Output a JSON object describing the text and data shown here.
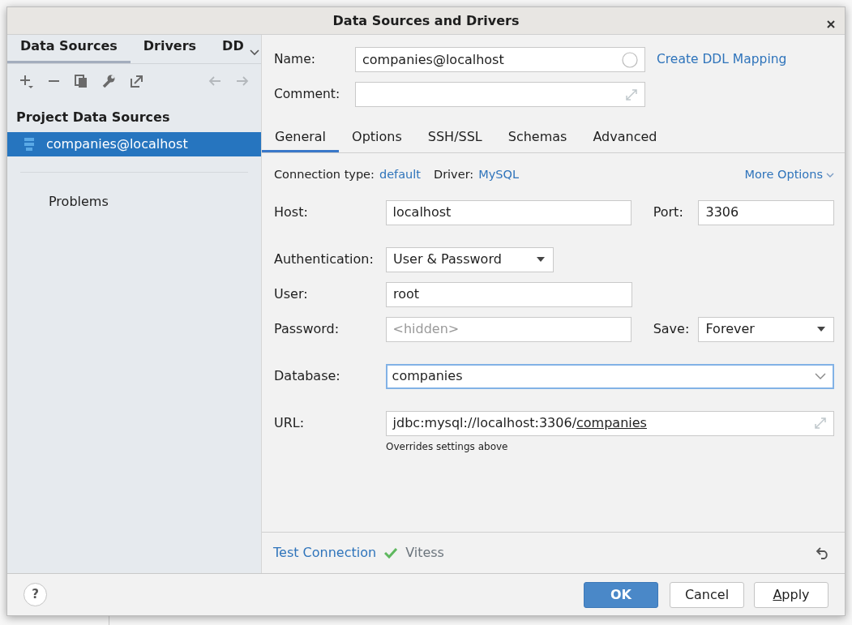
{
  "window": {
    "title": "Data Sources and Drivers"
  },
  "sidebar": {
    "tabs": [
      {
        "label": "Data Sources",
        "selected": true
      },
      {
        "label": "Drivers",
        "selected": false
      },
      {
        "label": "DD",
        "selected": false
      }
    ],
    "toolbar": [
      {
        "kind": "add",
        "disabled": false
      },
      {
        "kind": "remove",
        "disabled": false
      },
      {
        "kind": "copy",
        "disabled": false
      },
      {
        "kind": "wrench",
        "disabled": false
      },
      {
        "kind": "export",
        "disabled": false
      },
      {
        "kind": "back",
        "disabled": true
      },
      {
        "kind": "forward",
        "disabled": true
      }
    ],
    "section_title": "Project Data Sources",
    "items": [
      {
        "label": "companies@localhost",
        "selected": true
      }
    ],
    "problems": "Problems"
  },
  "header": {
    "name_label": "Name:",
    "name_value": "companies@localhost",
    "ddl_link": "Create DDL Mapping",
    "comment_label": "Comment:"
  },
  "tabs": [
    {
      "label": "General",
      "selected": true
    },
    {
      "label": "Options",
      "selected": false
    },
    {
      "label": "SSH/SSL",
      "selected": false
    },
    {
      "label": "Schemas",
      "selected": false
    },
    {
      "label": "Advanced",
      "selected": false
    }
  ],
  "general": {
    "connection_type_label": "Connection type:",
    "connection_type": "default",
    "driver_label": "Driver:",
    "driver": "MySQL",
    "more_options": "More Options",
    "host_label": "Host:",
    "host": "localhost",
    "port_label": "Port:",
    "port": "3306",
    "auth_label": "Authentication:",
    "auth": "User & Password",
    "user_label": "User:",
    "user": "root",
    "password_label": "Password:",
    "password_placeholder": "<hidden>",
    "save_label": "Save:",
    "save": "Forever",
    "database_label": "Database:",
    "database": "companies",
    "database_focused": true,
    "url_label": "URL:",
    "url_prefix": "jdbc:mysql://localhost:3306/",
    "url_database": "companies",
    "url_hint": "Overrides settings above"
  },
  "test": {
    "link": "Test Connection",
    "ok": true,
    "result": "Vitess"
  },
  "help": "?",
  "buttons": [
    {
      "label": "OK",
      "kind": "primary",
      "mnemonic": false
    },
    {
      "label": "Cancel",
      "kind": "default",
      "mnemonic": false
    },
    {
      "label": "Apply",
      "kind": "default",
      "mnemonic": true
    }
  ]
}
